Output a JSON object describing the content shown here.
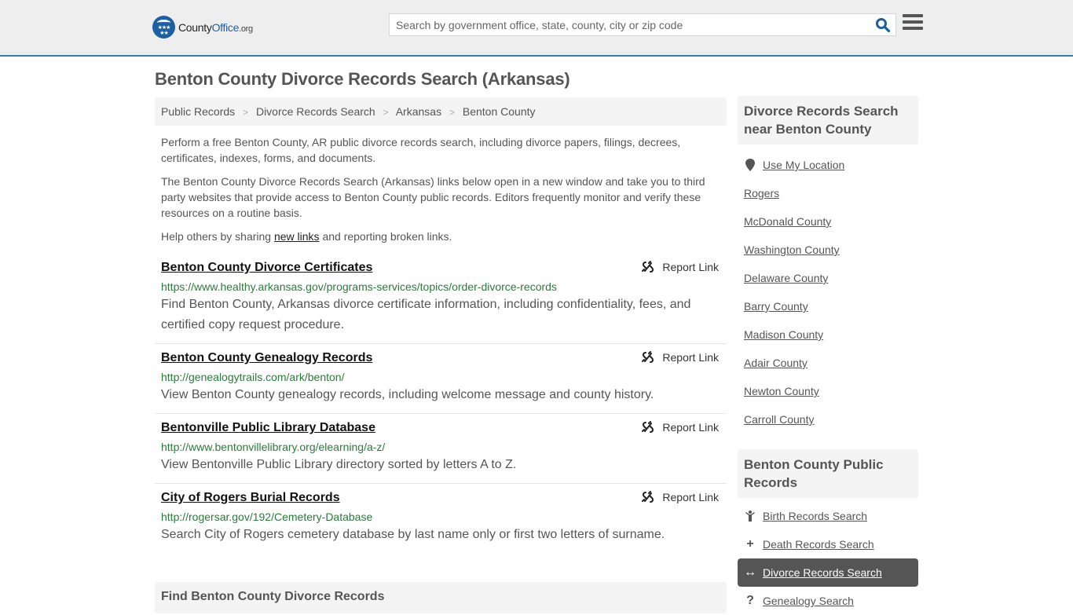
{
  "header": {
    "logo_county": "County",
    "logo_office": "Office",
    "logo_org": ".org",
    "search_placeholder": "Search by government office, state, county, city or zip code",
    "search_value": "",
    "accent_color": "#1d5fa3"
  },
  "page": {
    "title": "Benton County Divorce Records Search (Arkansas)",
    "breadcrumb": [
      "Public Records",
      "Divorce Records Search",
      "Arkansas",
      "Benton County"
    ],
    "breadcrumb_separator": ">",
    "intro_1": "Perform a free Benton County, AR public divorce records search, including divorce papers, filings, decrees, certificates, indexes, forms, and documents.",
    "intro_2": "The Benton County Divorce Records Search (Arkansas) links below open in a new window and take you to third party websites that provide access to Benton County public records. Editors frequently monitor and verify these resources on a routine basis.",
    "intro_3_before": "Help others by sharing ",
    "intro_3_link": "new links",
    "intro_3_after": " and reporting broken links."
  },
  "results": [
    {
      "title": "Benton County Divorce Certificates",
      "url": "https://www.healthy.arkansas.gov/programs-services/topics/order-divorce-records",
      "description": "Find Benton County, Arkansas divorce certificate information, including confidentiality, fees, and certified copy request procedure.",
      "report_label": "Report Link"
    },
    {
      "title": "Benton County Genealogy Records",
      "url": "http://genealogytrails.com/ark/benton/",
      "description": "View Benton County genealogy records, including welcome message and county history.",
      "report_label": "Report Link"
    },
    {
      "title": "Bentonville Public Library Database",
      "url": "http://www.bentonvillelibrary.org/elearning/a-z/",
      "description": "View Bentonville Public Library directory sorted by letters A to Z.",
      "report_label": "Report Link"
    },
    {
      "title": "City of Rogers Burial Records",
      "url": "http://rogersar.gov/192/Cemetery-Database",
      "description": "Search City of Rogers cemetery database by last name only or first two letters of surname.",
      "report_label": "Report Link"
    }
  ],
  "find_section": {
    "title": "Find Benton County Divorce Records"
  },
  "sidebar": {
    "nearby": {
      "title": "Divorce Records Search near Benton County",
      "use_location": "Use My Location",
      "items": [
        "Rogers",
        "McDonald County",
        "Washington County",
        "Delaware County",
        "Barry County",
        "Madison County",
        "Adair County",
        "Newton County",
        "Carroll County"
      ]
    },
    "public_records": {
      "title": "Benton County Public Records",
      "items": [
        {
          "label": "Birth Records Search",
          "icon": "child-icon",
          "glyph": "Ὣ8",
          "active": false
        },
        {
          "label": "Death Records Search",
          "icon": "plus-icon",
          "glyph": "+",
          "active": false
        },
        {
          "label": "Divorce Records Search",
          "icon": "arrows-horizontal-icon",
          "glyph": "↔",
          "active": true
        },
        {
          "label": "Genealogy Search",
          "icon": "question-icon",
          "glyph": "?",
          "active": false
        }
      ]
    }
  }
}
